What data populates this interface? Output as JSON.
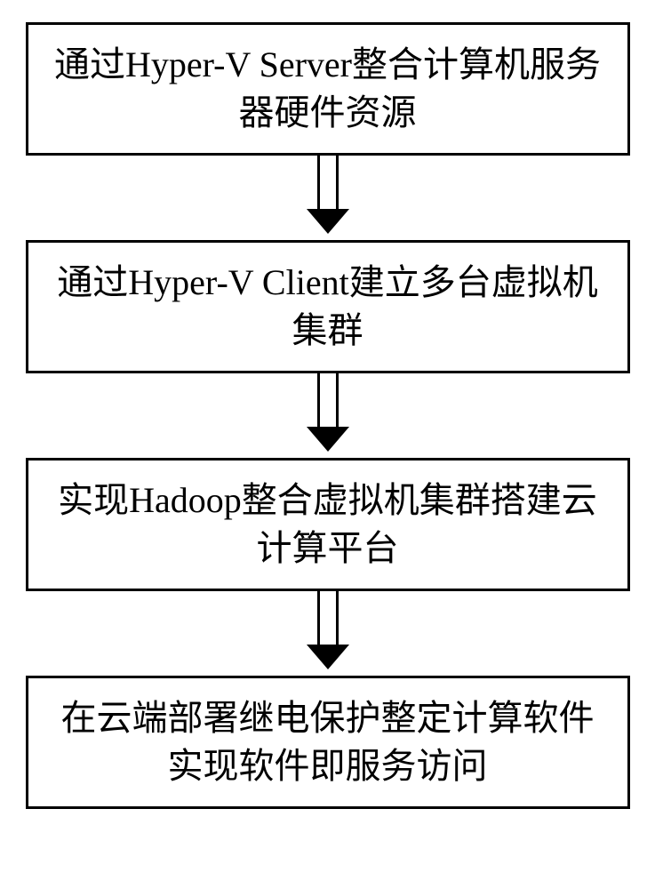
{
  "diagram": {
    "type": "flowchart",
    "direction": "vertical",
    "steps": [
      {
        "text": "通过Hyper-V Server整合计算机服务器硬件资源"
      },
      {
        "text": "通过Hyper-V Client建立多台虚拟机集群"
      },
      {
        "text": "实现Hadoop整合虚拟机集群搭建云计算平台"
      },
      {
        "text": "在云端部署继电保护整定计算软件实现软件即服务访问"
      }
    ]
  }
}
